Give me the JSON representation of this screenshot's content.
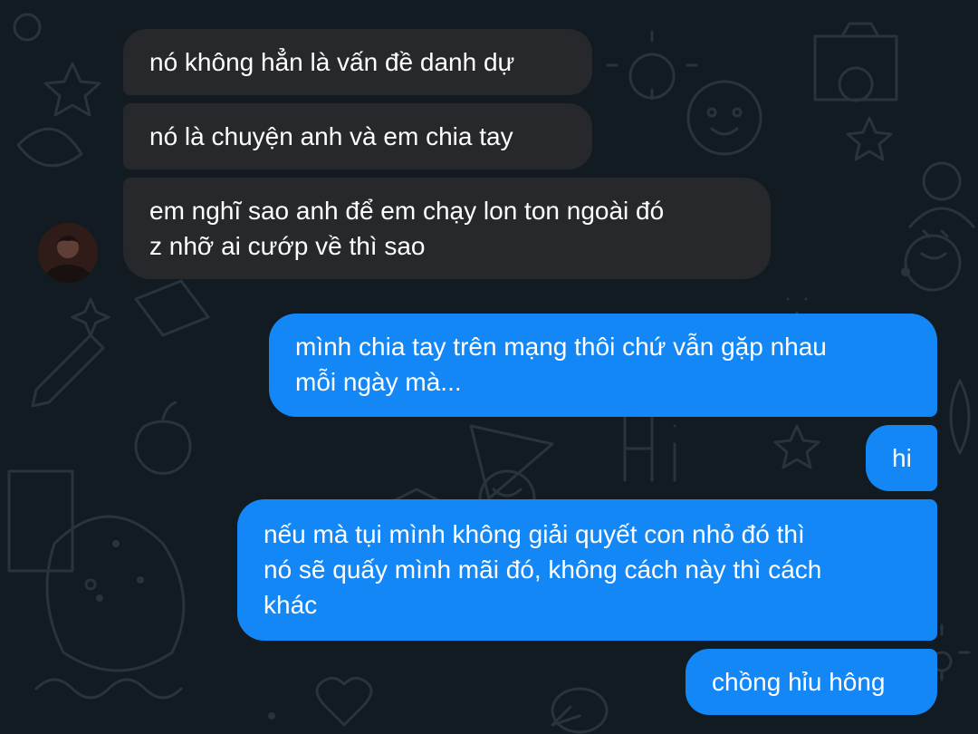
{
  "conversation": {
    "messages": [
      {
        "direction": "incoming",
        "text": "nó không hẳn là vấn đề danh dự"
      },
      {
        "direction": "incoming",
        "text": "nó là chuyện anh và em chia tay"
      },
      {
        "direction": "incoming",
        "lines": [
          "em nghĩ sao anh để em chạy lon ton ngoài đó",
          "z nhỡ ai cướp về thì sao"
        ]
      },
      {
        "direction": "outgoing",
        "lines": [
          "mình chia tay trên mạng thôi chứ vẫn gặp nhau",
          "mỗi ngày mà..."
        ]
      },
      {
        "direction": "outgoing",
        "text": "hi"
      },
      {
        "direction": "outgoing",
        "lines": [
          "nếu mà tụi mình không giải quyết con nhỏ đó thì",
          "nó sẽ quấy mình mãi đó, không cách này thì cách",
          "khác"
        ]
      },
      {
        "direction": "outgoing",
        "text": "chồng hỉu hông"
      }
    ]
  },
  "colors": {
    "background": "#131b22",
    "incoming_bubble": "#26282b",
    "outgoing_bubble": "#1387f5",
    "doodle": "#27333d",
    "text": "#ffffff"
  },
  "icons": {
    "sender_avatar": "avatar-photo"
  }
}
